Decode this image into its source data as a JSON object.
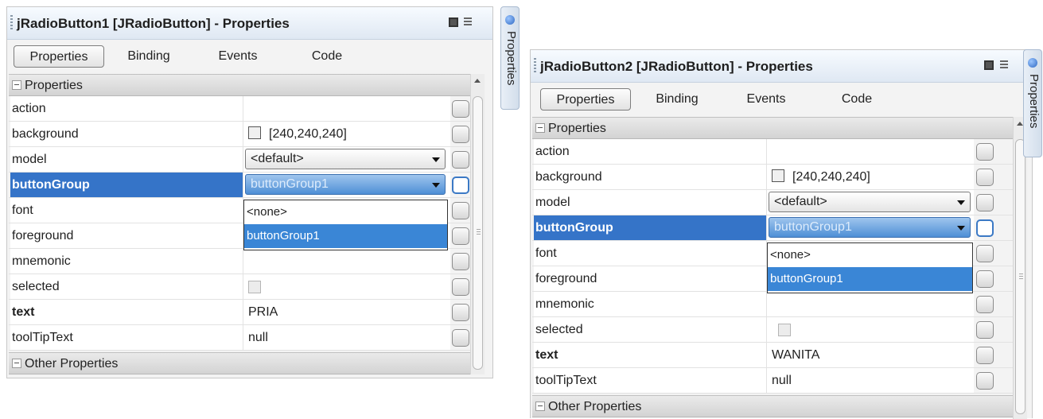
{
  "panels": [
    {
      "title": "jRadioButton1 [JRadioButton] - Properties",
      "tabs": [
        "Properties",
        "Binding",
        "Events",
        "Code"
      ],
      "section_properties": "Properties",
      "section_other": "Other Properties",
      "rows": [
        {
          "name": "action",
          "value": ""
        },
        {
          "name": "background",
          "value": "[240,240,240]"
        },
        {
          "name": "model",
          "value": "<default>"
        },
        {
          "name": "buttonGroup",
          "value": "buttonGroup1"
        },
        {
          "name": "font",
          "value": ""
        },
        {
          "name": "foreground",
          "value": ""
        },
        {
          "name": "mnemonic",
          "value": ""
        },
        {
          "name": "selected",
          "value": ""
        },
        {
          "name": "text",
          "value": "PRIA"
        },
        {
          "name": "toolTipText",
          "value": "null"
        }
      ],
      "dropdown": [
        "<none>",
        "buttonGroup1"
      ],
      "side_tab": "Properties"
    },
    {
      "title": "jRadioButton2 [JRadioButton] - Properties",
      "tabs": [
        "Properties",
        "Binding",
        "Events",
        "Code"
      ],
      "section_properties": "Properties",
      "section_other": "Other Properties",
      "rows": [
        {
          "name": "action",
          "value": ""
        },
        {
          "name": "background",
          "value": "[240,240,240]"
        },
        {
          "name": "model",
          "value": "<default>"
        },
        {
          "name": "buttonGroup",
          "value": "buttonGroup1"
        },
        {
          "name": "font",
          "value": ""
        },
        {
          "name": "foreground",
          "value": ""
        },
        {
          "name": "mnemonic",
          "value": ""
        },
        {
          "name": "selected",
          "value": ""
        },
        {
          "name": "text",
          "value": "WANITA"
        },
        {
          "name": "toolTipText",
          "value": "null"
        }
      ],
      "dropdown": [
        "<none>",
        "buttonGroup1"
      ],
      "side_tab": "Properties"
    }
  ],
  "colors": {
    "selection": "#3574c8",
    "dropdown_selection": "#3a86d6",
    "panel_bg": "#f3f3f3"
  },
  "icons": [
    "maximize-icon",
    "close-icon",
    "properties-side-tab-icon",
    "ellipsis-button",
    "dropdown-arrow-icon"
  ]
}
